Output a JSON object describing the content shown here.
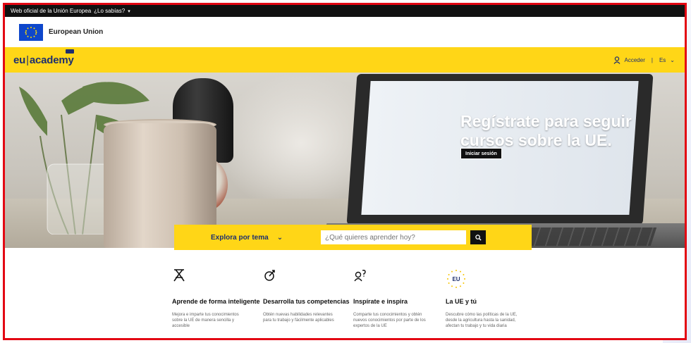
{
  "official_bar": {
    "text": "Web oficial de la Unión Europea",
    "link": "¿Lo sabías?"
  },
  "eu_header": {
    "label": "European Union"
  },
  "nav": {
    "logo_left": "eu",
    "logo_right": "academy",
    "login": "Acceder",
    "separator": "|",
    "language": "Es"
  },
  "hero": {
    "heading_line1": "Regístrate para seguir",
    "heading_line2": "cursos sobre la UE.",
    "button": "Iniciar sesión"
  },
  "search": {
    "topic_label": "Explora por tema",
    "placeholder": "¿Qué quieres aprender hoy?"
  },
  "features": [
    {
      "icon": "learning-icon",
      "title": "Aprende de forma inteligente",
      "text": "Mejora e imparte tus conocimientos sobre la UE de manera sencilla y accesible"
    },
    {
      "icon": "skills-icon",
      "title": "Desarrolla tus competencias",
      "text": "Obtén nuevas habilidades relevantes para tu trabajo y fácilmente aplicables"
    },
    {
      "icon": "inspire-icon",
      "title": "Inspírate e inspira",
      "text": "Comparte tus conocimientos y obtén nuevos conocimientos por parte de los expertos de la UE"
    },
    {
      "icon": "eu-stars-icon",
      "title": "La UE y tú",
      "text": "Descubre cómo las políticas de la UE, desde la agricultura hasta la sanidad, afectan tu trabajo y tu vida diaria",
      "badge": "EU"
    }
  ],
  "colors": {
    "accent": "#ffd617",
    "navy": "#1d2f6f",
    "frame": "#e30613"
  }
}
